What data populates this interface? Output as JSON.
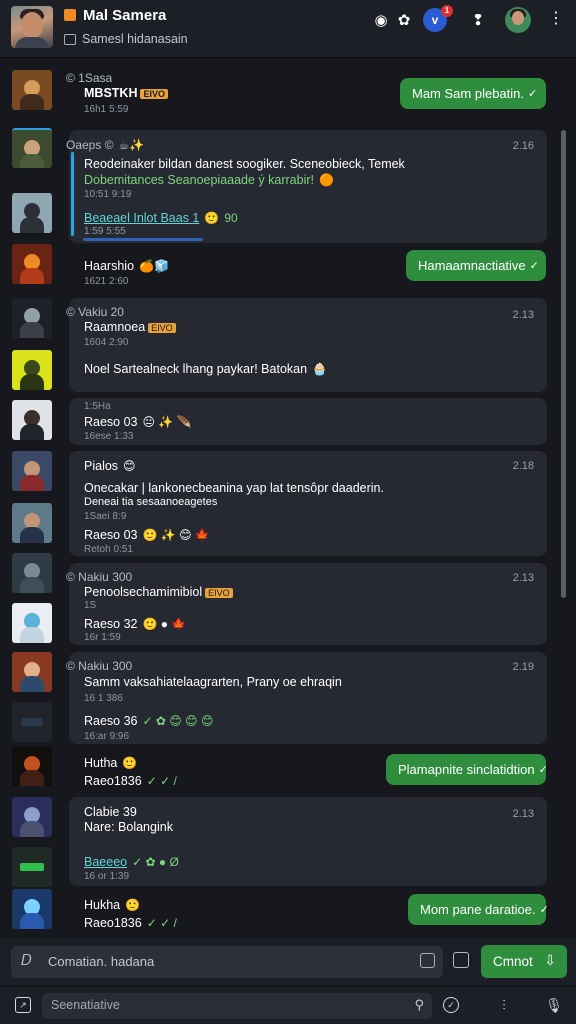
{
  "header": {
    "title": "Mal Samera",
    "subtitle": "Samesl hidanasain",
    "notification_count": "1",
    "blue_button_label": "v"
  },
  "colors": {
    "background": "#16181d",
    "card": "#262932",
    "accent_green": "#2f8e3e",
    "link_blue": "#5ec4ff",
    "tag_orange": "#e9a23b"
  },
  "messages": [
    {
      "meta": "© 1Sasa",
      "lines": [
        "MBSTKH",
        "16h1 5:59"
      ],
      "tag": "EIVO"
    },
    {
      "outgoing": "Mam Sam plebatin."
    },
    {
      "meta": "Oaeps ©",
      "time": "2.16",
      "lines": [
        "Reodeinaker bildan danest soogiker. Sceneobieck, Temek",
        "Dobemitances Seanoepiaaade ý karrabir!",
        "10:51 9:19",
        "Beaeael Inlot Baas 1",
        "1:59 5:55"
      ],
      "emoji_count": "90"
    },
    {
      "meta": "Haarshio",
      "lines": [
        "1621 2:60"
      ]
    },
    {
      "outgoing": "Hamaamnactiative"
    },
    {
      "meta": "© Vakiu 20",
      "time": "2.13",
      "lines": [
        "Raamnoea",
        "1604 2:90",
        "Noel Sartealneck lhang paykar! Batokan"
      ],
      "tag": "EIVO"
    },
    {
      "meta": "1:5Ha",
      "lines": [
        "Raeso 03",
        "16ese 1:33"
      ]
    },
    {
      "meta": "Pialos",
      "time": "2.18",
      "lines": [
        "Onecakar | lankonecbeanina yap lat tensôpr daaderin.",
        "Deneai tia sesaanoeagetes",
        "1Saei 8:9",
        "Raeso 03",
        "Retoh 0:51"
      ]
    },
    {
      "meta": "© Nakiu 300",
      "time": "2.13",
      "lines": [
        "Penoolsechamimibiol",
        "1S",
        "Raeso 32",
        "16r 1:59"
      ],
      "tag": "EIVO"
    },
    {
      "meta": "© Nakiu 300",
      "time": "2.19",
      "lines": [
        "Samm vaksahiatelaagrarten, Prany oe ehraqin",
        "16 1 386",
        "Raeso 36",
        "16:ar 9:96"
      ]
    },
    {
      "meta": "Hutha",
      "lines": [
        "Raeo1836"
      ]
    },
    {
      "outgoing": "Plamapnite sinclatidtion"
    },
    {
      "meta": "Clabie 39",
      "time": "2.13",
      "lines": [
        "Nare: Bolangink",
        "Baeeeo",
        "16 or 1:39"
      ]
    },
    {
      "meta": "Hukha",
      "lines": [
        "Raeo1836"
      ]
    },
    {
      "outgoing": "Mom pane daratioe."
    }
  ],
  "composer": {
    "placeholder": "Comatian. hadana",
    "send_label": "Cmnot"
  },
  "bottom_bar": {
    "search_placeholder": "Seenatiative"
  }
}
